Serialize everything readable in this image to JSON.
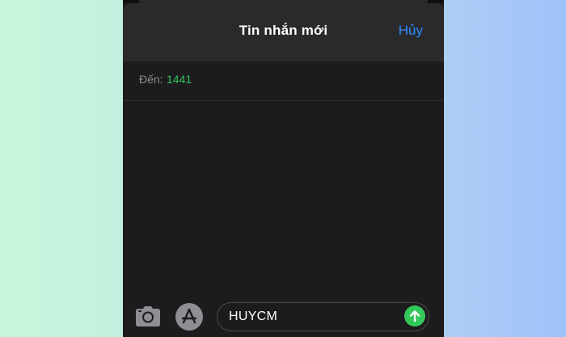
{
  "header": {
    "title": "Tin nhắn mới",
    "cancel_label": "Hủy"
  },
  "recipient": {
    "label": "Đến:",
    "value": "1441"
  },
  "composer": {
    "message_text": "HUYCM",
    "icons": {
      "camera": "camera-icon",
      "apps": "app-store-icon",
      "send": "send-arrow-up-icon"
    }
  },
  "colors": {
    "accent_blue": "#2f8cff",
    "recipient_green": "#34c759",
    "send_green": "#34c759",
    "sheet_background": "#1c1c1e",
    "header_background": "#2a2a2c"
  }
}
